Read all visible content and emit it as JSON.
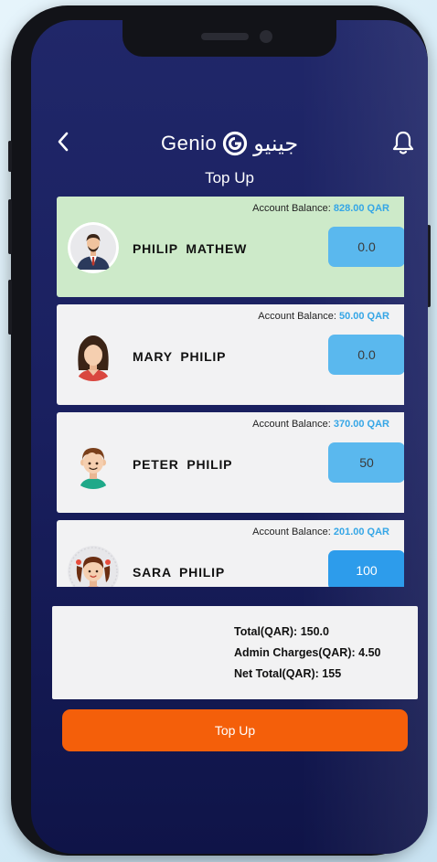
{
  "header": {
    "brand_en": "Genio",
    "brand_ar": "جينيو",
    "title": "Top Up"
  },
  "accounts": [
    {
      "name": "PHILIP  MATHEW",
      "balance_label": "Account Balance:",
      "balance": "828.00 QAR",
      "amount": "0.0",
      "selected": true
    },
    {
      "name": "MARY  PHILIP",
      "balance_label": "Account Balance:",
      "balance": "50.00 QAR",
      "amount": "0.0",
      "selected": false
    },
    {
      "name": "PETER  PHILIP",
      "balance_label": "Account Balance:",
      "balance": "370.00 QAR",
      "amount": "50",
      "selected": false
    },
    {
      "name": "SARA  PHILIP",
      "balance_label": "Account Balance:",
      "balance": "201.00 QAR",
      "amount": "100",
      "selected": false
    }
  ],
  "summary": {
    "total_label": "Total(QAR):",
    "total_value": "150.0",
    "admin_label": "Admin Charges(QAR):",
    "admin_value": "4.50",
    "net_label": "Net Total(QAR):",
    "net_value": "155"
  },
  "actions": {
    "topup_label": "Top Up"
  },
  "colors": {
    "screen_bg": "#1c2363",
    "selected_card": "#cdeac9",
    "card": "#f2f2f3",
    "balance_amount": "#35a6e6",
    "amount_field": "#5ab8ee",
    "amount_field_active": "#2d9ceb",
    "topup_button": "#f45f0a"
  },
  "icons": {
    "back": "chevron-left-icon",
    "notifications": "bell-icon",
    "brand": "genio-g-logo"
  }
}
